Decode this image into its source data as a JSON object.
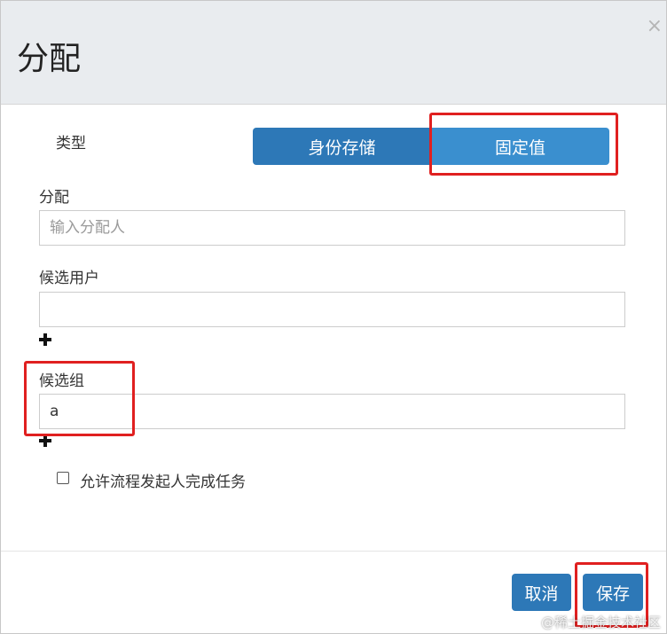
{
  "dialog": {
    "title": "分配",
    "close_icon": "close-icon",
    "close_glyph": "×"
  },
  "type": {
    "label": "类型",
    "options": [
      "身份存储",
      "固定值"
    ],
    "selected": "固定值"
  },
  "assignee": {
    "label": "分配",
    "placeholder": "输入分配人",
    "value": ""
  },
  "candidate_users": {
    "label": "候选用户",
    "value": "",
    "add_icon": "plus-icon"
  },
  "candidate_groups": {
    "label": "候选组",
    "value": "a",
    "add_icon": "plus-icon"
  },
  "allow_initiator": {
    "label": "允许流程发起人完成任务",
    "checked": false
  },
  "footer": {
    "cancel_label": "取消",
    "save_label": "保存"
  },
  "watermark": "@稀土掘金技术社区",
  "colors": {
    "primary": "#2d78b7",
    "active": "#3a8fcf",
    "highlight": "#e02020",
    "header_bg": "#e9ecef"
  }
}
